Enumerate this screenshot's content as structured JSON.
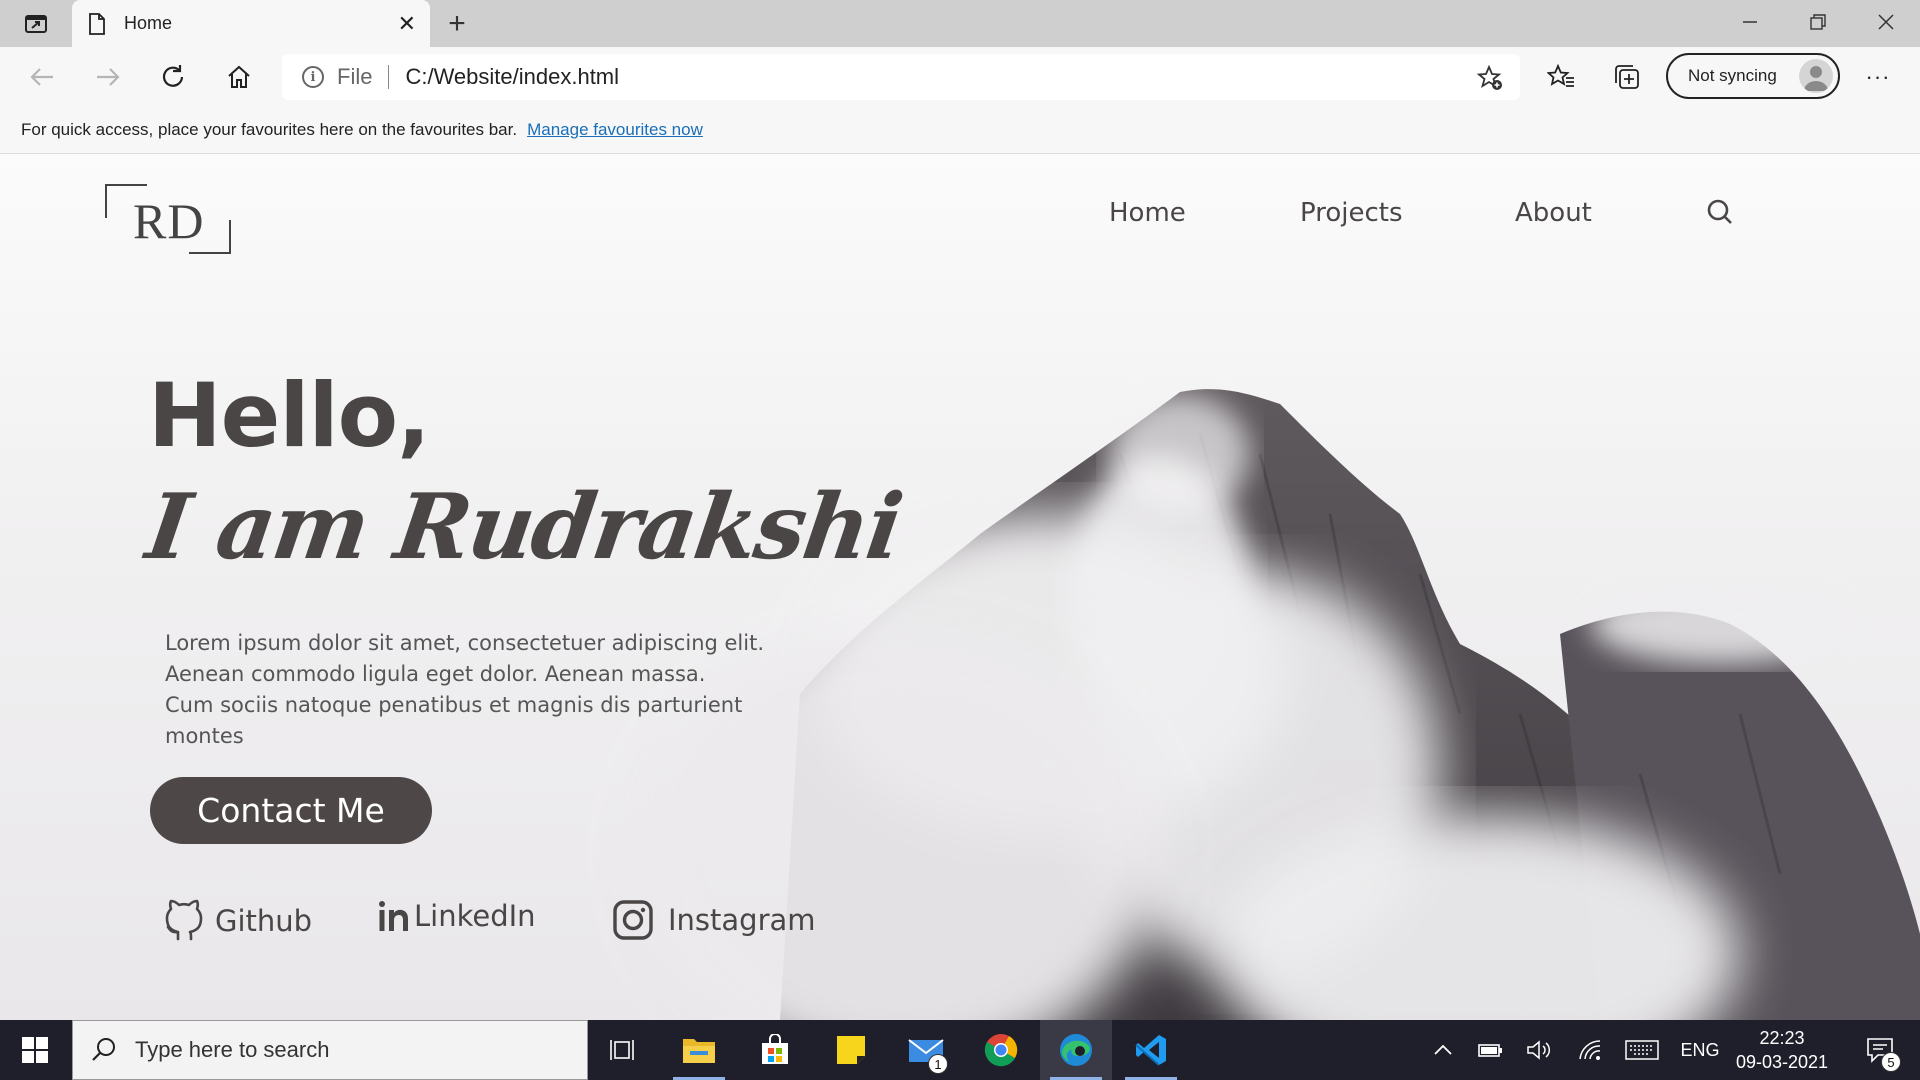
{
  "browser": {
    "tab_title": "Home",
    "tab_close": "✕",
    "new_tab": "+",
    "address": {
      "scheme_label": "File",
      "url": "C:/Website/index.html"
    },
    "sync_label": "Not syncing",
    "more_label": "···",
    "favourites_bar": {
      "message": "For quick access, place your favourites here on the favourites bar.",
      "link_text": "Manage favourites now"
    }
  },
  "site": {
    "logo_text": "RD",
    "nav": [
      "Home",
      "Projects",
      "About"
    ],
    "hero": {
      "greeting": "Hello,",
      "name_line": "I am Rudrakshi",
      "intro_lines": [
        "Lorem ipsum dolor sit amet, consectetuer adipiscing elit.",
        "Aenean commodo ligula eget dolor. Aenean massa.",
        "Cum sociis natoque penatibus et magnis dis parturient",
        "montes"
      ],
      "cta": "Contact Me"
    },
    "social": [
      {
        "label": "Github",
        "icon": "github-icon"
      },
      {
        "label": "LinkedIn",
        "icon": "linkedin-icon"
      },
      {
        "label": "Instagram",
        "icon": "instagram-icon"
      }
    ]
  },
  "taskbar": {
    "search_placeholder": "Type here to search",
    "mail_badge": "1",
    "language": "ENG",
    "time": "22:23",
    "date": "09-03-2021",
    "notifications_badge": "5"
  },
  "colors": {
    "accent": "#4d4747",
    "link": "#1a6fb8",
    "taskbar": "#1f1f2b"
  }
}
